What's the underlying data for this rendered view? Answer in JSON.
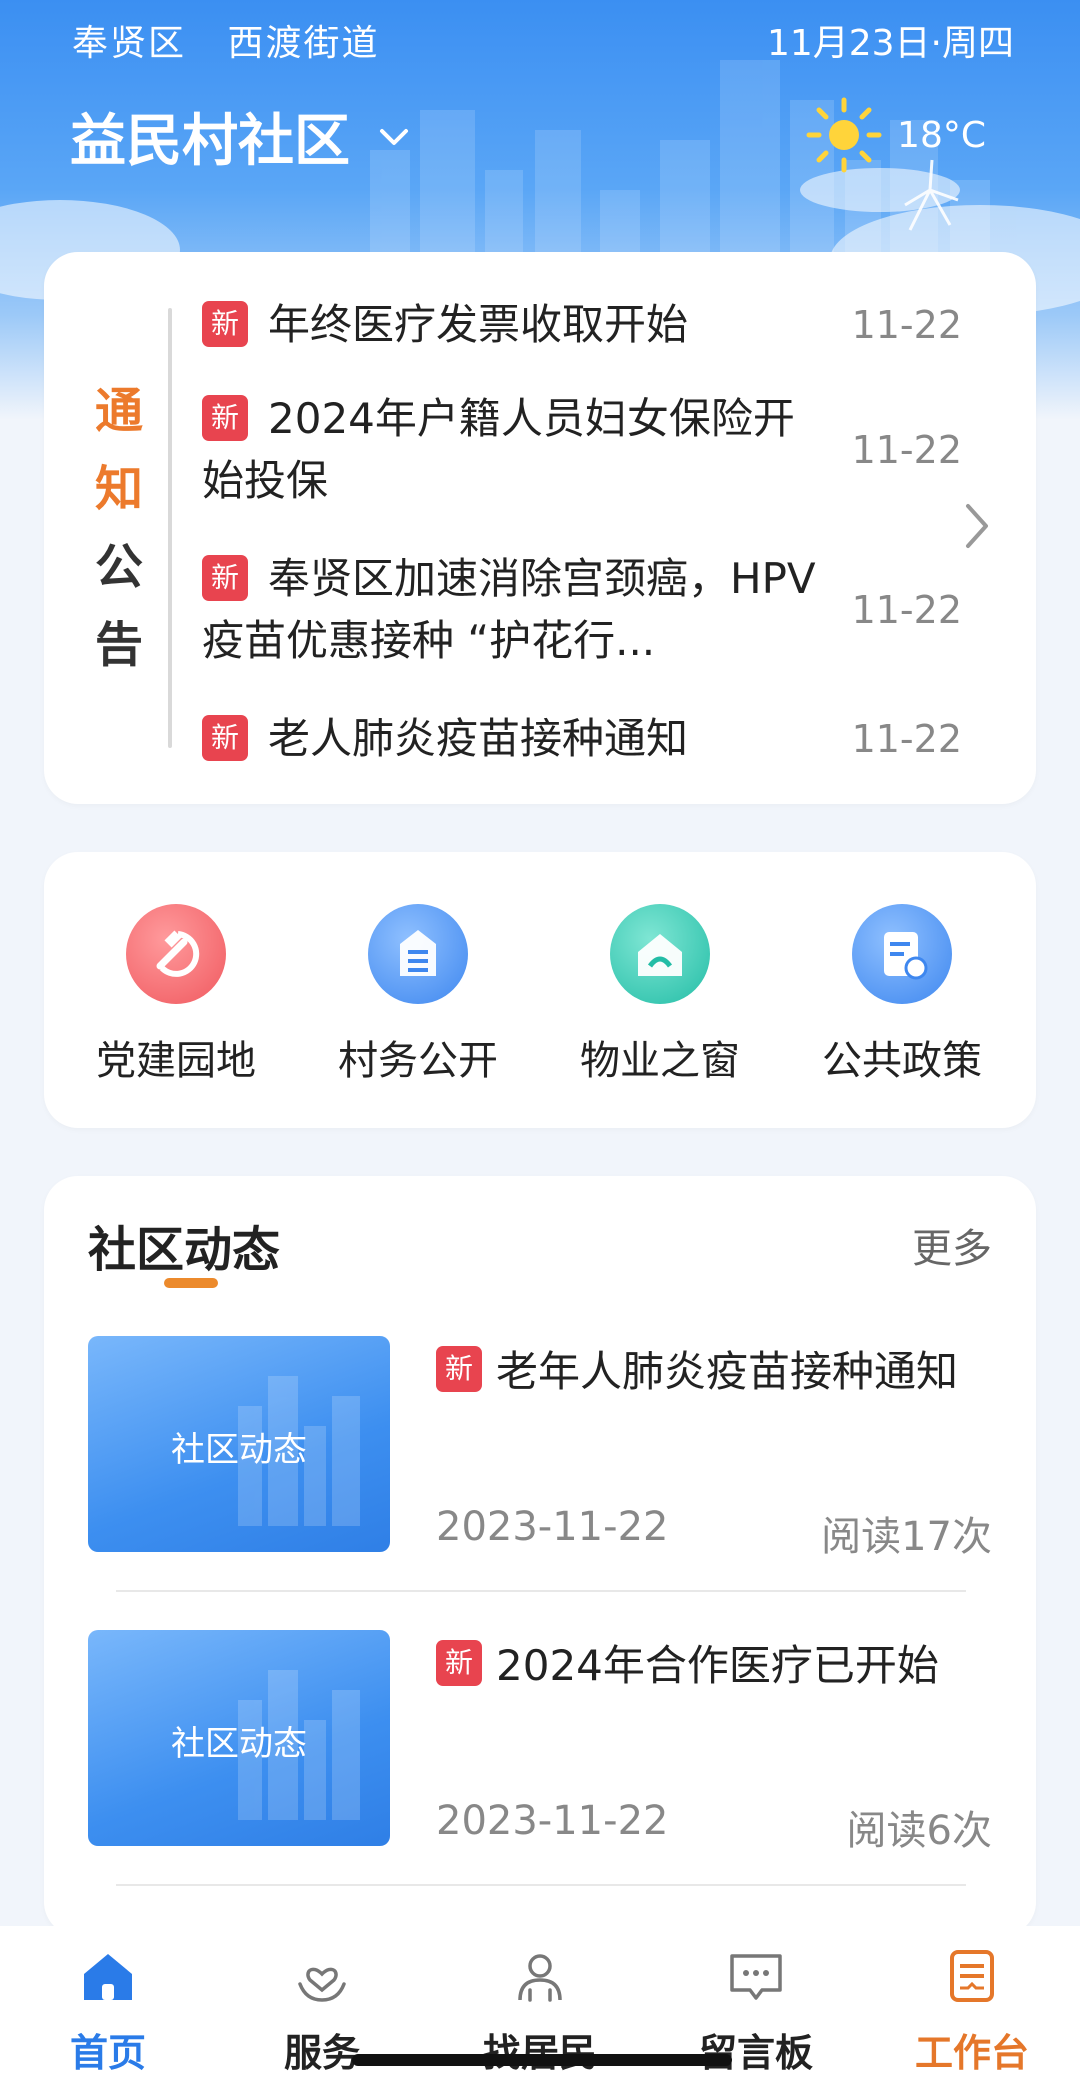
{
  "header": {
    "district": "奉贤区",
    "street": "西渡街道",
    "date": "11月23日·周四",
    "community": "益民村社区",
    "temperature": "18°C",
    "weather_icon": "sun-icon"
  },
  "notice": {
    "title_chars": [
      "通",
      "知",
      "公",
      "告"
    ],
    "items": [
      {
        "badge": "新",
        "text": "年终医疗发票收取开始",
        "date": "11-22"
      },
      {
        "badge": "新",
        "text": "2024年户籍人员妇女保险开始投保",
        "date": "11-22"
      },
      {
        "badge": "新",
        "text": "奉贤区加速消除宫颈癌，HPV疫苗优惠接种 “护花行...",
        "date": "11-22"
      },
      {
        "badge": "新",
        "text": "老人肺炎疫苗接种通知",
        "date": "11-22"
      }
    ]
  },
  "quick": [
    {
      "label": "党建园地",
      "icon": "party-emblem-icon",
      "color": "#f36b6f"
    },
    {
      "label": "村务公开",
      "icon": "document-icon",
      "color": "#4f95f2"
    },
    {
      "label": "物业之窗",
      "icon": "house-icon",
      "color": "#2fc7b1"
    },
    {
      "label": "公共政策",
      "icon": "policy-icon",
      "color": "#4f95f2"
    }
  ],
  "news": {
    "title": "社区动态",
    "more": "更多",
    "items": [
      {
        "thumb_label": "社区动态",
        "badge": "新",
        "text": "老年人肺炎疫苗接种通知",
        "date": "2023-11-22",
        "reads": "阅读17次"
      },
      {
        "thumb_label": "社区动态",
        "badge": "新",
        "text": "2024年合作医疗已开始",
        "date": "2023-11-22",
        "reads": "阅读6次"
      }
    ]
  },
  "tabs": [
    {
      "label": "首页",
      "icon": "home-icon",
      "active": true
    },
    {
      "label": "服务",
      "icon": "service-heart-icon"
    },
    {
      "label": "找居民",
      "icon": "residents-icon"
    },
    {
      "label": "留言板",
      "icon": "message-board-icon"
    },
    {
      "label": "工作台",
      "icon": "workbench-icon"
    }
  ],
  "colors": {
    "primary": "#2a7be8",
    "accent_orange": "#ec7a2c",
    "badge_red": "#e8444f"
  }
}
